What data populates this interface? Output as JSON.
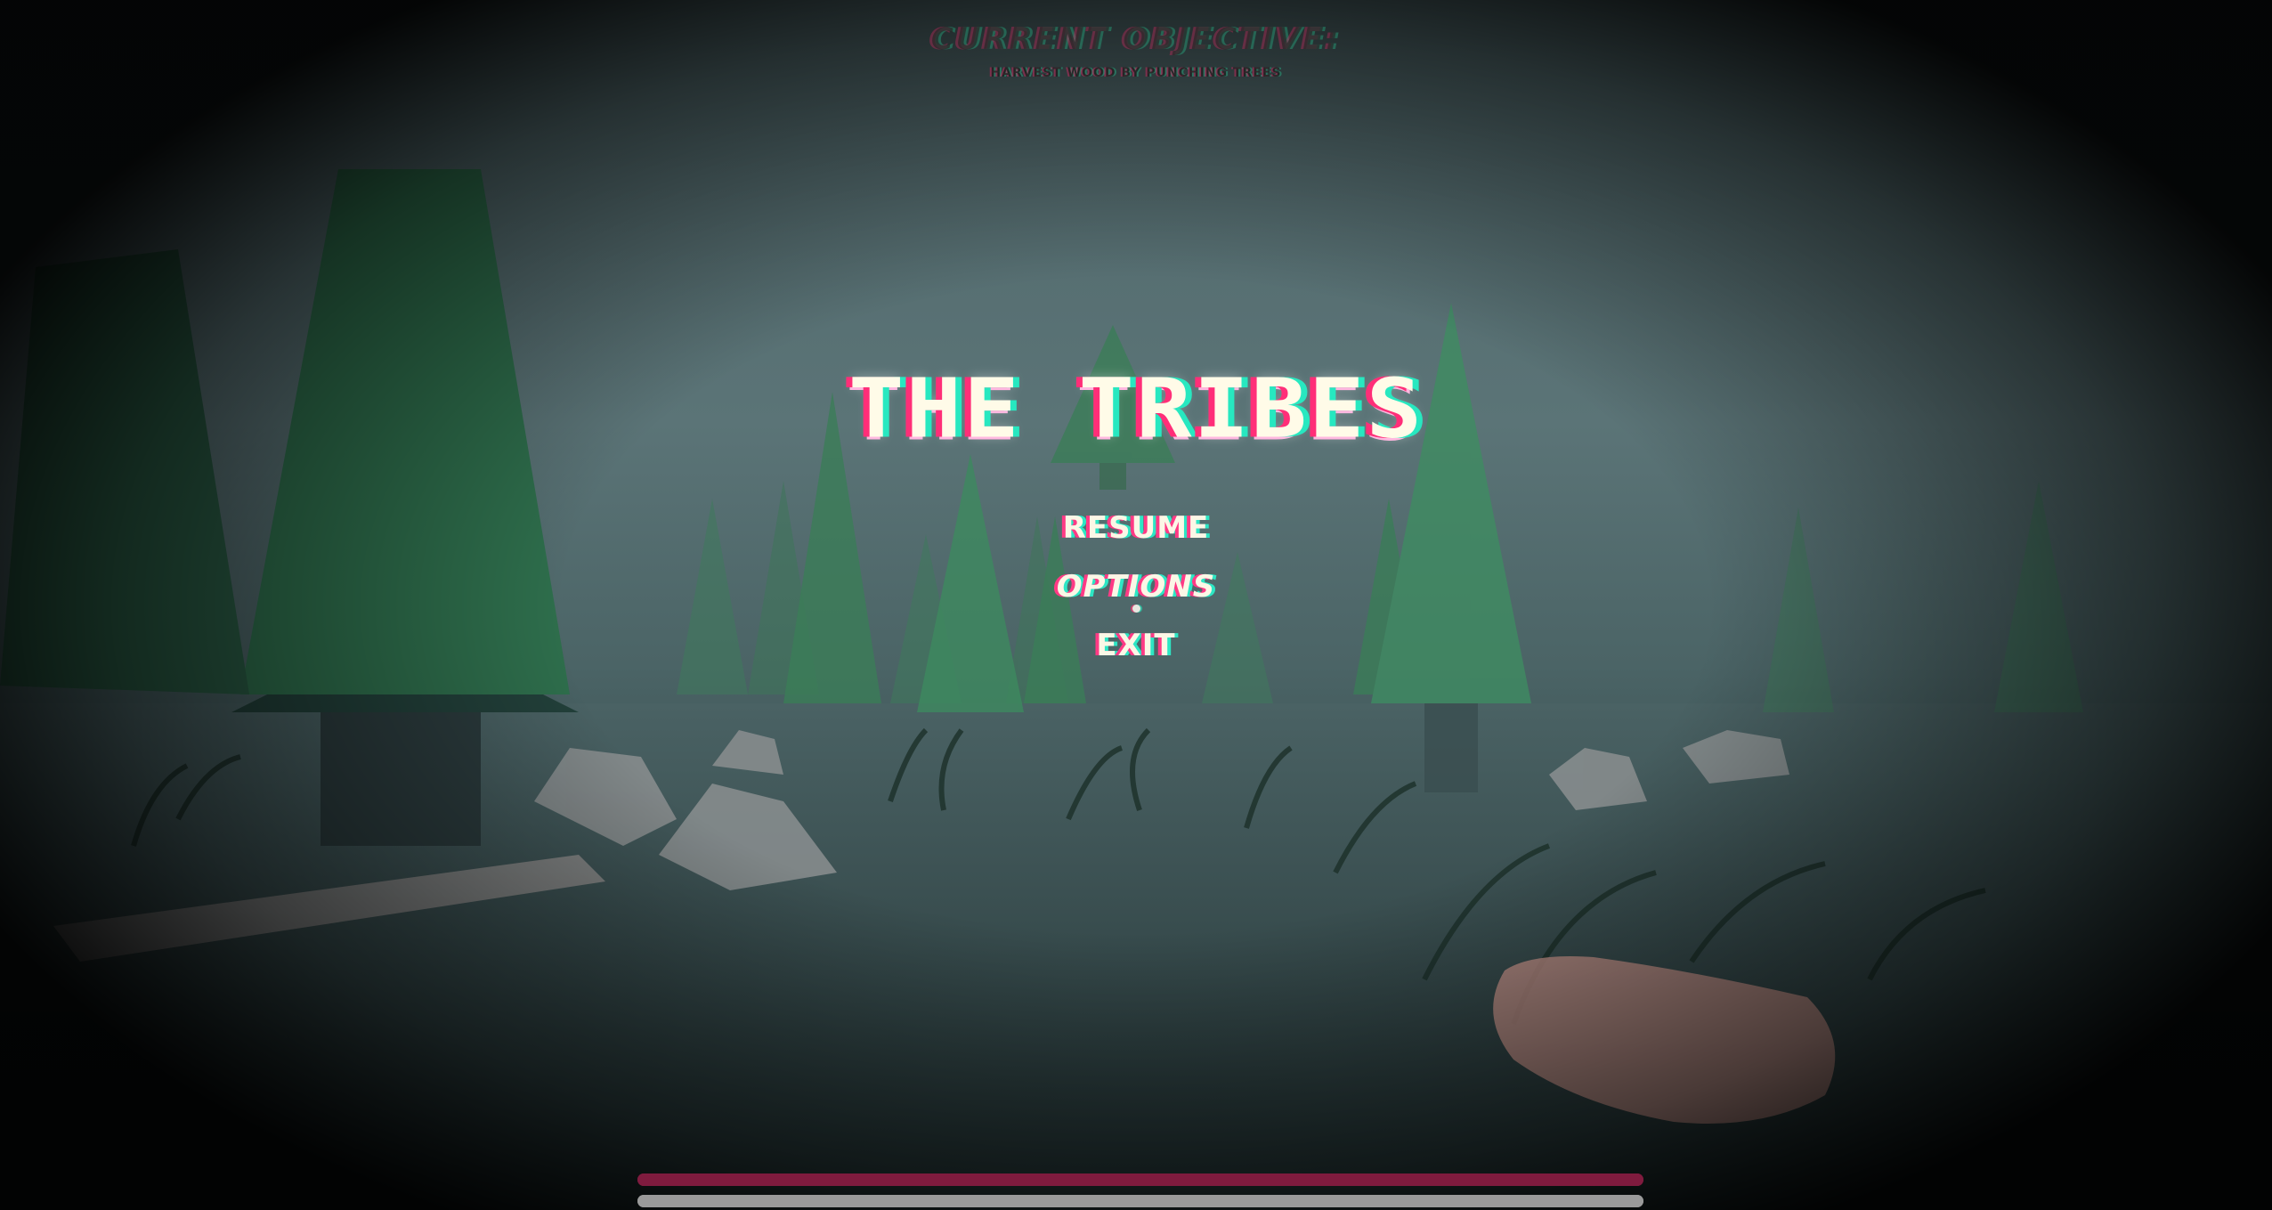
{
  "hud": {
    "objective_title": "CURRENT OBJECTIVE:",
    "objective_text": "HARVEST WOOD BY PUNCHING TREES"
  },
  "pause_menu": {
    "game_title": "THE TRIBES",
    "items": [
      {
        "label": "RESUME"
      },
      {
        "label": "OPTIONS"
      },
      {
        "label": "EXIT"
      }
    ]
  },
  "status_bars": {
    "health": {
      "level": 1.0,
      "color": "#8a1d42"
    },
    "stamina": {
      "level": 1.0,
      "color": "#8c8c8c"
    }
  },
  "colors": {
    "glitch_red": "#ff2e78",
    "glitch_cyan": "#27e8c0",
    "text": "#fffbe8"
  }
}
